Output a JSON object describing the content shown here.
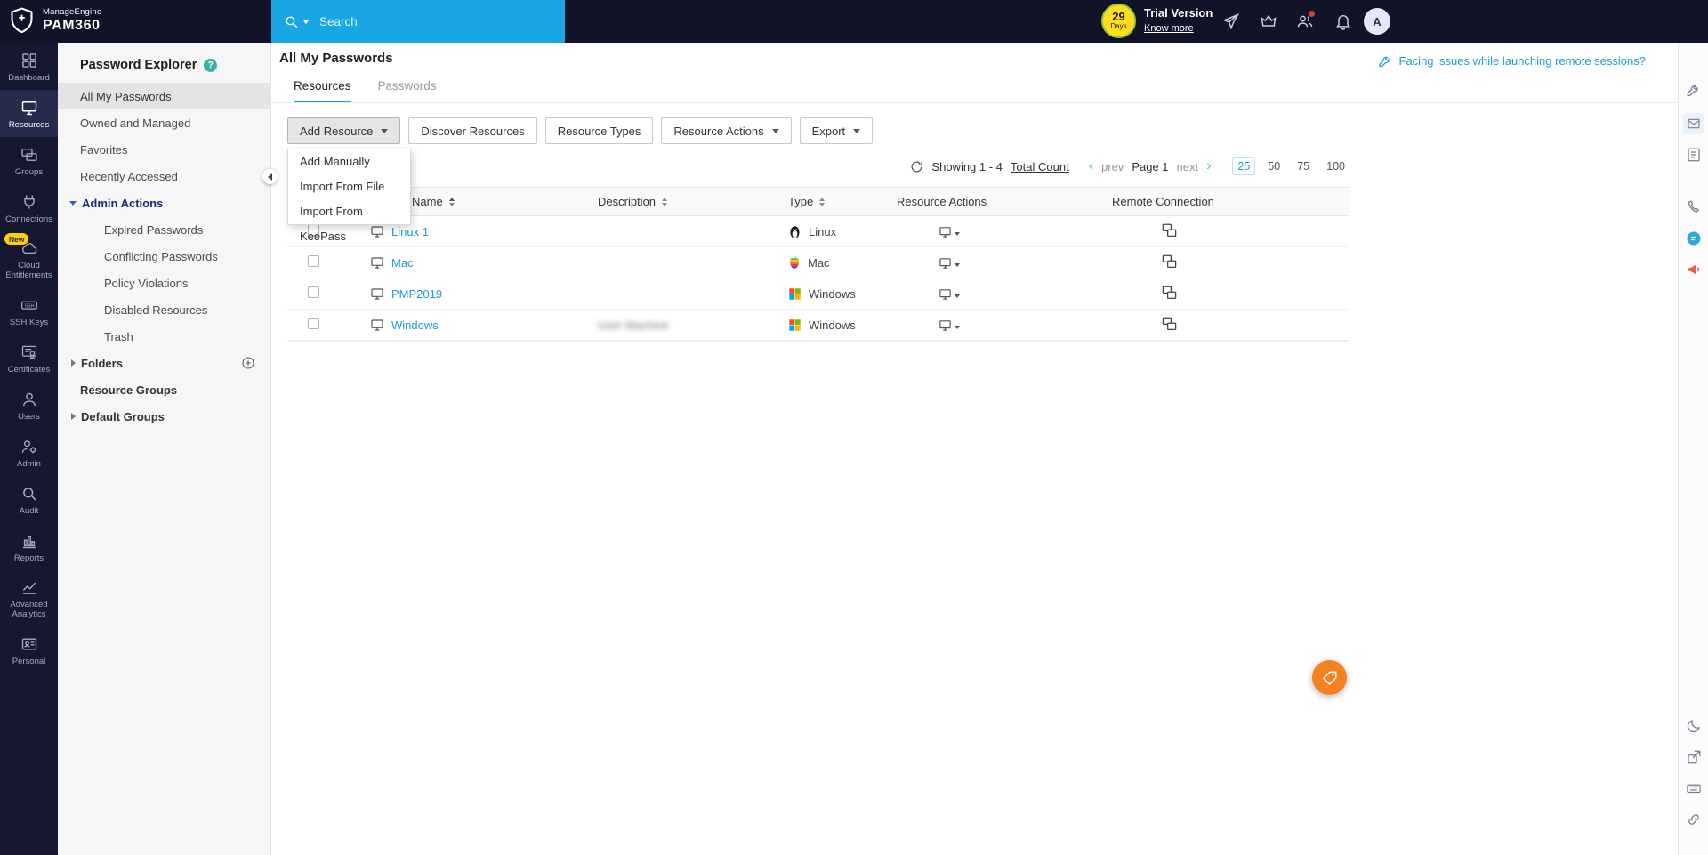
{
  "colors": {
    "accent_blue": "#1e9cd7",
    "header_bg": "#111327",
    "search_bg": "#18a7e4",
    "fab_orange": "#f58220",
    "badge_yellow": "#ffce0a",
    "windows_logo": [
      "#f25022",
      "#7fba00",
      "#00a4ef",
      "#ffb900"
    ]
  },
  "icons": {
    "search": "magnifier",
    "whats_new": "paper-plane",
    "license": "crown",
    "user_sessions": "people",
    "notifications": "bell",
    "help": "question-circle",
    "refresh": "circular-arrows",
    "resource": "monitor",
    "remote_connection": "overlapping-screens",
    "fab": "price-tag"
  },
  "header": {
    "brand_top": "ManageEngine",
    "brand_bottom": "PAM360",
    "search_placeholder": "Search",
    "trial_days_value": "29",
    "trial_days_label": "Days",
    "trial_title": "Trial Version",
    "trial_link": "Know more",
    "avatar_letter": "A"
  },
  "nav_rail": {
    "active": "Resources",
    "items": [
      {
        "label": "Dashboard"
      },
      {
        "label": "Resources"
      },
      {
        "label": "Groups"
      },
      {
        "label": "Connections"
      },
      {
        "label": "Cloud Entitlements",
        "badge": "New"
      },
      {
        "label": "SSH Keys"
      },
      {
        "label": "Certificates"
      },
      {
        "label": "Users"
      },
      {
        "label": "Admin"
      },
      {
        "label": "Audit"
      },
      {
        "label": "Reports"
      },
      {
        "label": "Advanced Analytics"
      },
      {
        "label": "Personal"
      }
    ]
  },
  "sidebar": {
    "title": "Password Explorer",
    "help_glyph": "?",
    "selected": "All My Passwords",
    "items": {
      "all_my_passwords": "All My Passwords",
      "owned_and_managed": "Owned and Managed",
      "favorites": "Favorites",
      "recently_accessed": "Recently Accessed",
      "admin_actions": "Admin Actions",
      "expired_passwords": "Expired Passwords",
      "conflicting_passwords": "Conflicting Passwords",
      "policy_violations": "Policy Violations",
      "disabled_resources": "Disabled Resources",
      "trash": "Trash",
      "folders": "Folders",
      "resource_groups": "Resource Groups",
      "default_groups": "Default Groups"
    }
  },
  "main": {
    "title": "All My Passwords",
    "help_link": "Facing issues while launching remote sessions?",
    "tabs": {
      "resources": "Resources",
      "passwords": "Passwords"
    },
    "toolbar": {
      "add_resource": "Add Resource",
      "discover_resources": "Discover Resources",
      "resource_types": "Resource Types",
      "resource_actions": "Resource Actions",
      "export": "Export"
    },
    "add_resource_menu": {
      "add_manually": "Add Manually",
      "import_from_file": "Import From File",
      "import_from_keepass": "Import From KeePass"
    },
    "pagination": {
      "showing": "Showing 1 - 4",
      "total_count": "Total Count",
      "prev_chevron": "‹",
      "prev": "prev",
      "page": "Page 1",
      "next": "next",
      "next_chevron": "›",
      "size_25": "25",
      "size_50": "50",
      "size_75": "75",
      "size_100": "100",
      "active_size": "25"
    },
    "table": {
      "col_name": "Name",
      "col_description": "Description",
      "col_type": "Type",
      "col_resource_actions": "Resource Actions",
      "col_remote_connection": "Remote Connection",
      "rows": [
        {
          "name": "Linux 1",
          "description": "",
          "type": "Linux"
        },
        {
          "name": "Mac",
          "description": "",
          "type": "Mac"
        },
        {
          "name": "PMP2019",
          "description": "",
          "type": "Windows"
        },
        {
          "name": "Windows",
          "description": "User Machine",
          "type": "Windows",
          "description_blurred": true
        }
      ]
    }
  }
}
